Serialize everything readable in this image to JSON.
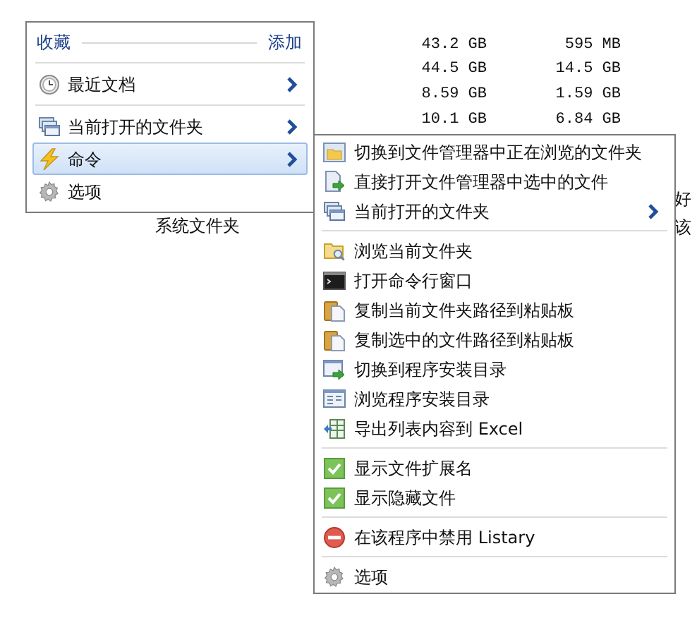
{
  "background": {
    "size_rows": [
      [
        "43.2 GB",
        "595 MB"
      ],
      [
        "44.5 GB",
        "14.5 GB"
      ],
      [
        "8.59 GB",
        "1.59 GB"
      ],
      [
        "10.1 GB",
        "6.84 GB"
      ]
    ],
    "folder_label": "系统文件夹",
    "edge_texts": [
      "好",
      "该"
    ]
  },
  "favorites_menu": {
    "title": "收藏",
    "action": "添加",
    "groups": [
      [
        {
          "label": "最近文档",
          "submenu": true,
          "selected": false
        }
      ],
      [
        {
          "label": "当前打开的文件夹",
          "submenu": true,
          "selected": false
        },
        {
          "label": "命令",
          "submenu": true,
          "selected": true
        },
        {
          "label": "选项",
          "submenu": false,
          "selected": false
        }
      ]
    ]
  },
  "command_menu": {
    "groups": [
      [
        {
          "kind": "command",
          "label": "切换到文件管理器中正在浏览的文件夹",
          "submenu": false
        },
        {
          "kind": "command",
          "label": "直接打开文件管理器中选中的文件",
          "submenu": false
        },
        {
          "kind": "command",
          "label": "当前打开的文件夹",
          "submenu": true
        }
      ],
      [
        {
          "kind": "command",
          "label": "浏览当前文件夹",
          "submenu": false
        },
        {
          "kind": "command",
          "label": "打开命令行窗口",
          "submenu": false
        },
        {
          "kind": "command",
          "label": "复制当前文件夹路径到粘贴板",
          "submenu": false
        },
        {
          "kind": "command",
          "label": "复制选中的文件路径到粘贴板",
          "submenu": false
        },
        {
          "kind": "command",
          "label": "切换到程序安装目录",
          "submenu": false
        },
        {
          "kind": "command",
          "label": "浏览程序安装目录",
          "submenu": false
        },
        {
          "kind": "command",
          "label": "导出列表内容到 Excel",
          "submenu": false
        }
      ],
      [
        {
          "kind": "toggle",
          "label": "显示文件扩展名",
          "checked": true
        },
        {
          "kind": "toggle",
          "label": "显示隐藏文件",
          "checked": true
        }
      ],
      [
        {
          "kind": "command",
          "label": "在该程序中禁用 Listary",
          "submenu": false
        }
      ],
      [
        {
          "kind": "command",
          "label": "选项",
          "submenu": false
        }
      ]
    ]
  }
}
